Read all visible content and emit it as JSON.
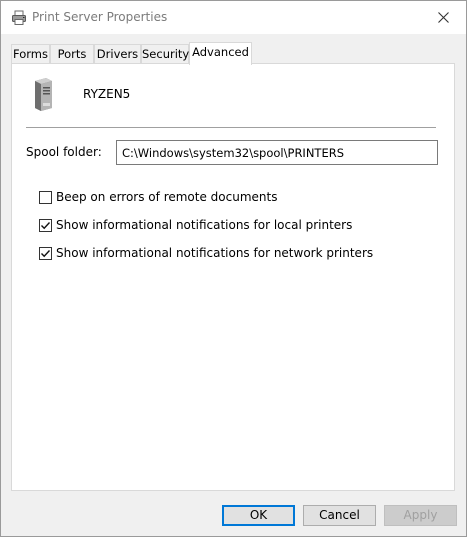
{
  "window": {
    "title": "Print Server Properties",
    "title_icon": "printer-icon",
    "close_icon": "close-icon"
  },
  "tabs": [
    {
      "label": "Forms",
      "active": false
    },
    {
      "label": "Ports",
      "active": false
    },
    {
      "label": "Drivers",
      "active": false
    },
    {
      "label": "Security",
      "active": false
    },
    {
      "label": "Advanced",
      "active": true
    }
  ],
  "advanced": {
    "server_icon": "server-tower-icon",
    "server_name": "RYZEN5",
    "spool_label": "Spool folder:",
    "spool_value": "C:\\Windows\\system32\\spool\\PRINTERS",
    "options": [
      {
        "label": "Beep on errors of remote documents",
        "checked": false
      },
      {
        "label": "Show informational notifications for local printers",
        "checked": true
      },
      {
        "label": "Show informational notifications for network printers",
        "checked": true
      }
    ]
  },
  "buttons": {
    "ok": "OK",
    "cancel": "Cancel",
    "apply": "Apply"
  },
  "colors": {
    "default_button_border": "#0078d7",
    "window_background": "#f0f0f0",
    "panel_background": "#ffffff"
  }
}
